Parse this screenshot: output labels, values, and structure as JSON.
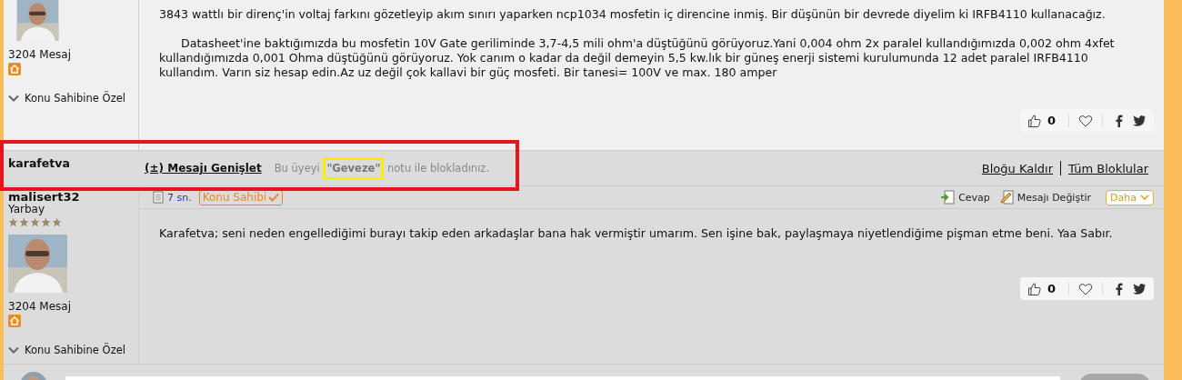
{
  "posts": [
    {
      "kind": "message",
      "message_count": "3204 Mesaj",
      "owner_menu": "Konu Sahibine Özel",
      "paragraphs": [
        {
          "indent": false,
          "lines": [
            "3843 wattlı bir direnç'in voltaj farkını gözetleyip akım sınırı yaparken ncp1034 mosfetin iç direncine inmiş. Bir düşünün bir devrede diyelim ki IRFB4110 kullanacağız."
          ]
        },
        {
          "indent": true,
          "lines": [
            "Datasheet'ine baktığımızda bu mosfetin 10V Gate geriliminde 3,7-4,5 mili ohm'a düştüğünü görüyoruz.Yani 0,004 ohm 2x paralel kullandığımızda 0,002 ohm 4xfet",
            "kullandığımızda 0,001 Ohma düştüğünü görüyoruz. Yok canım o kadar da değil demeyin 5,5 kw.lık bir güneş enerji sistemi kurulumunda 12 adet paralel IRFB4110",
            "kullandım. Varın siz hesap edin.Az uz değil çok kallavi bir güç mosfeti. Bir tanesi= 100V ve max. 180 amper"
          ]
        }
      ],
      "likes": "0"
    },
    {
      "kind": "blocked",
      "author": "karafetva",
      "expand_link": "(±) Mesajı Genişlet",
      "notice": "Bu üyeyi **\"Geveze\"** notu ile blokladınız.",
      "highlighted": true,
      "keyword_highlighted": true,
      "actions": [
        "Bloğu Kaldır",
        "Tüm Bloklular"
      ]
    },
    {
      "kind": "message",
      "author": "malisert32",
      "rank": "Yarbay",
      "stars": 5,
      "message_count": "3204 Mesaj",
      "owner_menu": "Konu Sahibine Özel",
      "time": "7 sn.",
      "owner_badge": "Konu Sahibi",
      "reply": "Cevap",
      "edit": "Mesajı Değiştir",
      "more": "Daha",
      "paragraphs": [
        {
          "indent": false,
          "lines": [
            "Karafetva; seni neden engellediğimi burayı takip eden arkadaşlar bana hak vermiştir umarım. Sen işine bak, paylaşmaya niyetlendiğime pişman etme beni. Yaa Sabır."
          ]
        }
      ],
      "likes": "0"
    }
  ]
}
